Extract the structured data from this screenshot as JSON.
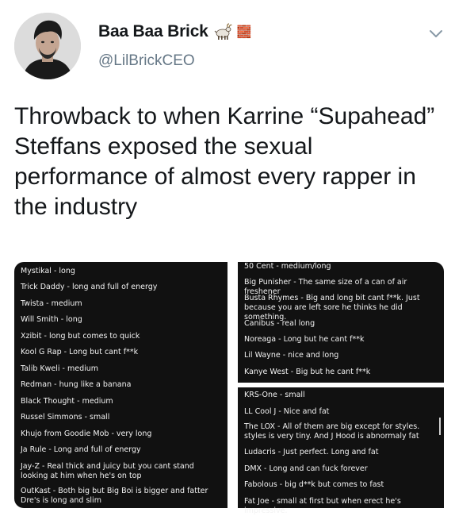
{
  "author": {
    "display_name": "Baa Baa Brick",
    "name_emoji_brick": "🧱",
    "handle": "@LilBrickCEO"
  },
  "icons": {
    "name_emoji": "goat-icon",
    "brick": "brick-icon",
    "caret": "chevron-down-icon",
    "avatar": "avatar"
  },
  "tweet": {
    "text": "Throwback to when Karrine “Supahead” Steffans exposed the sexual performance of almost every rapper in the industry"
  },
  "images": {
    "left": [
      "Mystikal - long",
      "Trick Daddy - long and full of energy",
      "Twista - medium",
      "Will Smith - long",
      "Xzibit - long but comes to quick",
      "Kool G Rap - Long but cant f**k",
      "Talib Kweli - medium",
      "Redman - hung like a banana",
      "Black Thought - medium",
      "Russel Simmons - small",
      "Khujo from Goodie Mob - very long",
      "Ja Rule - Long and full of energy",
      "Jay-Z - Real thick and juicy but you cant stand looking at him when he's on top",
      "OutKast - Both big but Big Boi is bigger and fatter Dre's is long and slim"
    ],
    "right_top": [
      "50 Cent - medium/long",
      "Big Punisher - The same size of a can of air freshener",
      "Busta Rhymes - Big and long bit cant f**k. Just because you are left sore he thinks he did something.",
      "Canibus - real long",
      "Noreaga - Long but he cant f**k",
      "Lil Wayne - nice and long",
      "Kanye West - Big but he cant f**k"
    ],
    "right_bottom": [
      "KRS-One - small",
      "LL Cool J - Nice and fat",
      "The LOX - All of them are big except for styles. styles is very tiny. And J Hood is abnormaly fat",
      "Ludacris - Just perfect. Long and fat",
      "DMX - Long and can fuck forever",
      "Fabolous - big d**k but comes to fast",
      "Fat Joe - small at first but when erect he's impressive."
    ]
  }
}
